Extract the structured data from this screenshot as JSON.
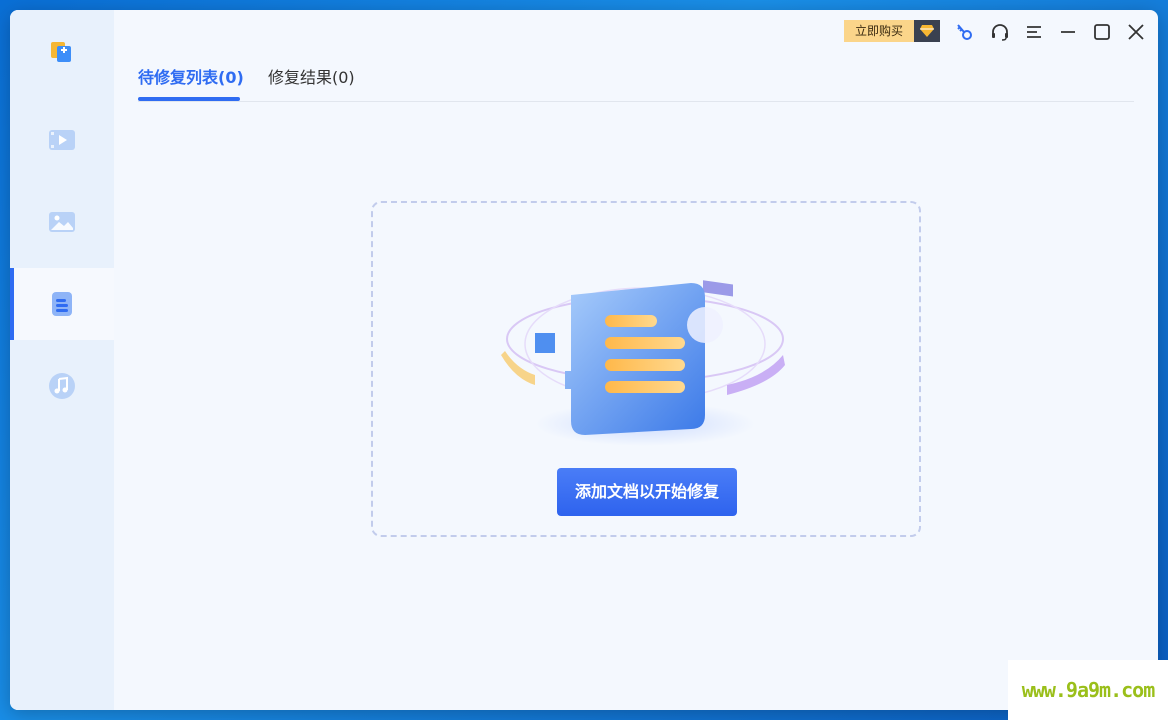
{
  "topbar": {
    "buy_label": "立即购买",
    "icons": [
      "diamond-icon",
      "key-icon",
      "headset-icon",
      "menu-icon",
      "minimize-icon",
      "maximize-icon",
      "close-icon"
    ]
  },
  "sidebar": {
    "items": [
      {
        "name": "video-repair",
        "icon": "video-icon",
        "active": false
      },
      {
        "name": "photo-repair",
        "icon": "image-icon",
        "active": false
      },
      {
        "name": "document-repair",
        "icon": "document-icon",
        "active": true
      },
      {
        "name": "audio-repair",
        "icon": "music-icon",
        "active": false
      }
    ]
  },
  "tabs": [
    {
      "label": "待修复列表(0)",
      "active": true
    },
    {
      "label": "修复结果(0)",
      "active": false
    }
  ],
  "main": {
    "add_button_label": "添加文档以开始修复"
  },
  "watermark": "www.9a9m.com",
  "colors": {
    "accent": "#2f6cf2",
    "buy": "#fbd58a",
    "sidebar": "#e8f1fc",
    "background": "#f4f8fe"
  }
}
